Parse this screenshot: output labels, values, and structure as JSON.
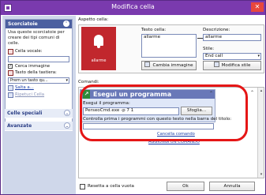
{
  "window": {
    "title": "Modifica cella",
    "close_glyph": "✕"
  },
  "left_panel": {
    "shortcuts": {
      "title": "Scorciatoie",
      "description": "Usa queste scorciatoie per creare dei tipi comuni di celle.",
      "voice_cell": "Cella vocale:",
      "search_image": "Cerca immagine",
      "keyboard_key": "Tasto della tastiera:",
      "keyboard_select": "Prem un tasto qu...",
      "jump": "Salta a...",
      "repeat_cell": "Ripetuci Cella"
    },
    "special_cells": {
      "title": "Celle speciali"
    },
    "advanced": {
      "title": "Avanzate"
    }
  },
  "appearance": {
    "label": "Aspetto cella:",
    "preview_caption": "allarme",
    "cell_text_label": "Testo cella:",
    "cell_text_value": "allarme",
    "description_label": "Descrizione:",
    "description_value": "allarme",
    "change_image": "Cambia immagine",
    "style_label": "Stile:",
    "style_value": "End call",
    "edit_style": "Modifica stile"
  },
  "commands": {
    "label": "Comandi:",
    "card": {
      "title": "Esegui un programma",
      "program_label": "Esegui il programma:",
      "program_value": "PerseoCmd.exe -p 7 1",
      "browse": "Sfoglia...",
      "check_title": "Controlla prima i programmi con questo testo nella barra del titolo:"
    },
    "delete_command": "Cancella comando",
    "add_command": "AGGIUNGI UN COMANDO"
  },
  "footer": {
    "reset_empty": "Resetta a cella vuota",
    "ok": "Ok",
    "cancel": "Annulla"
  }
}
